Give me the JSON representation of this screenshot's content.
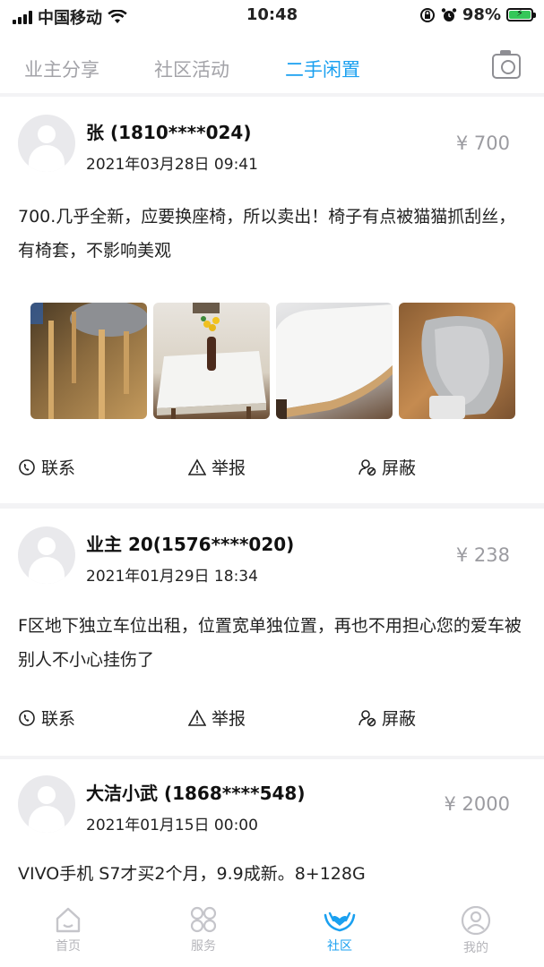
{
  "status_bar": {
    "carrier": "中国移动",
    "time": "10:48",
    "battery": "98%",
    "battery_level": 0.98
  },
  "tabs": [
    {
      "label": "业主分享"
    },
    {
      "label": "社区活动"
    },
    {
      "label": "二手闲置"
    }
  ],
  "active_tab": "二手闲置",
  "accent_color": "#1aa0f0",
  "posts": [
    {
      "name": "张 (1810****024)",
      "date": "2021年03月28日 09:41",
      "price": "¥ 700",
      "content": "700.几乎全新，应要换座椅，所以卖出！椅子有点被猫猫抓刮丝，有椅套，不影响美观",
      "photo_count": 4
    },
    {
      "name": "业主 20(1576****020)",
      "date": "2021年01月29日 18:34",
      "price": "¥ 238",
      "content": "F区地下独立车位出租，位置宽单独位置，再也不用担心您的爱车被别人不小心挂伤了"
    },
    {
      "name": "大洁小武 (1868****548)",
      "date": "2021年01月15日 00:00",
      "price": "¥ 2000",
      "content": "VIVO手机 S7才买2个月，9.9成新。8+128G"
    }
  ],
  "actions": {
    "contact": "联系",
    "report": "举报",
    "block": "屏蔽"
  },
  "tabbar": [
    {
      "label": "首页",
      "icon": "home-icon"
    },
    {
      "label": "服务",
      "icon": "grid-icon"
    },
    {
      "label": "社区",
      "icon": "community-icon"
    },
    {
      "label": "我的",
      "icon": "profile-icon"
    }
  ],
  "tabbar_active": "社区"
}
